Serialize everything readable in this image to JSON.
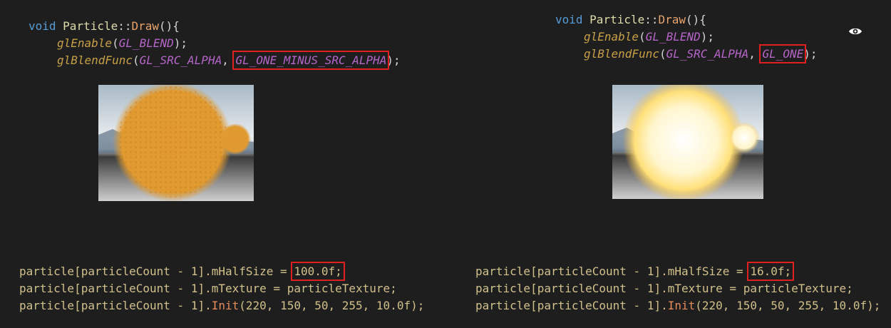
{
  "left": {
    "draw_sig": {
      "kw": "void",
      "cls": "Particle",
      "sep": "::",
      "fn": "Draw",
      "tail": "(){"
    },
    "enable": {
      "fn": "glEnable",
      "open": "(",
      "arg": "GL_BLEND",
      "close": ");"
    },
    "blendfunc": {
      "fn": "glBlendFunc",
      "open": "(",
      "arg1": "GL_SRC_ALPHA",
      "comma": ", ",
      "arg2": "GL_ONE_MINUS_SRC_ALPHA",
      "close": ");"
    },
    "lines": [
      {
        "obj": "particle",
        "idx": "[particleCount - 1]",
        "field": ".mHalfSize = ",
        "value": "100.0f;",
        "rest": ""
      },
      {
        "obj": "particle",
        "idx": "[particleCount - 1]",
        "field": ".mTexture = ",
        "value": "particleTexture;",
        "rest": ""
      },
      {
        "obj": "particle",
        "idx": "[particleCount - 1]",
        "field": ".",
        "value": "Init",
        "rest": "(220, 150, 50, 255, 10.0f);"
      }
    ]
  },
  "right": {
    "draw_sig": {
      "kw": "void",
      "cls": "Particle",
      "sep": "::",
      "fn": "Draw",
      "tail": "(){"
    },
    "enable": {
      "fn": "glEnable",
      "open": "(",
      "arg": "GL_BLEND",
      "close": ");"
    },
    "blendfunc": {
      "fn": "glBlendFunc",
      "open": "(",
      "arg1": "GL_SRC_ALPHA",
      "comma": ", ",
      "arg2": "GL_ONE",
      "close": ");"
    },
    "lines": [
      {
        "obj": "particle",
        "idx": "[particleCount - 1]",
        "field": ".mHalfSize = ",
        "value": "16.0f;",
        "rest": ""
      },
      {
        "obj": "particle",
        "idx": "[particleCount - 1]",
        "field": ".mTexture = ",
        "value": "particleTexture;",
        "rest": ""
      },
      {
        "obj": "particle",
        "idx": "[particleCount - 1]",
        "field": ".",
        "value": "Init",
        "rest": "(220, 150, 50, 255, 10.0f);"
      }
    ]
  },
  "colors": {
    "background": "#1e1e1e",
    "highlight_box": "#e02020",
    "particle_orange": "#e09a30",
    "particle_glow": "#fff6d0"
  },
  "icons": {
    "eye": "eye-icon"
  }
}
